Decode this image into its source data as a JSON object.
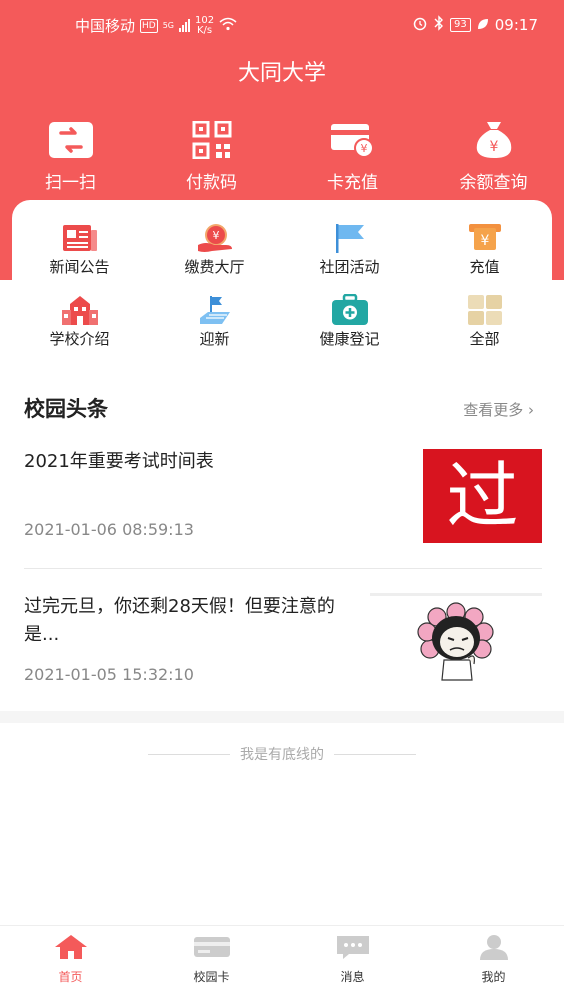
{
  "statusbar": {
    "carrier": "中国移动",
    "hd": "HD",
    "network": "5G",
    "speed_value": "102",
    "speed_unit": "K/s",
    "battery": "93",
    "time": "09:17"
  },
  "app_title": "大同大学",
  "quick_actions": [
    {
      "label": "扫一扫",
      "icon": "scan-icon"
    },
    {
      "label": "付款码",
      "icon": "qrcode-icon"
    },
    {
      "label": "卡充值",
      "icon": "card-topup-icon"
    },
    {
      "label": "余额查询",
      "icon": "balance-bag-icon"
    }
  ],
  "services": [
    {
      "label": "新闻公告",
      "icon": "newspaper-icon"
    },
    {
      "label": "缴费大厅",
      "icon": "payment-hand-icon"
    },
    {
      "label": "社团活动",
      "icon": "flag-icon"
    },
    {
      "label": "充值",
      "icon": "recharge-icon"
    },
    {
      "label": "学校介绍",
      "icon": "school-building-icon"
    },
    {
      "label": "迎新",
      "icon": "welcome-flag-icon"
    },
    {
      "label": "健康登记",
      "icon": "medical-kit-icon"
    },
    {
      "label": "全部",
      "icon": "all-grid-icon"
    }
  ],
  "news": {
    "section_title": "校园头条",
    "more_label": "查看更多",
    "items": [
      {
        "title": "2021年重要考试时间表",
        "date": "2021-01-06 08:59:13",
        "thumb_text": "过"
      },
      {
        "title": "过完元旦，你还剩28天假！但要注意的是...",
        "date": "2021-01-05 15:32:10",
        "thumb_text": ""
      }
    ]
  },
  "footer_text": "我是有底线的",
  "tabs": [
    {
      "label": "首页",
      "icon": "home-icon",
      "active": true
    },
    {
      "label": "校园卡",
      "icon": "campus-card-icon",
      "active": false
    },
    {
      "label": "消息",
      "icon": "message-icon",
      "active": false
    },
    {
      "label": "我的",
      "icon": "profile-icon",
      "active": false
    }
  ],
  "colors": {
    "brand": "#f45a5a",
    "inactive_icon": "#cccccc"
  }
}
